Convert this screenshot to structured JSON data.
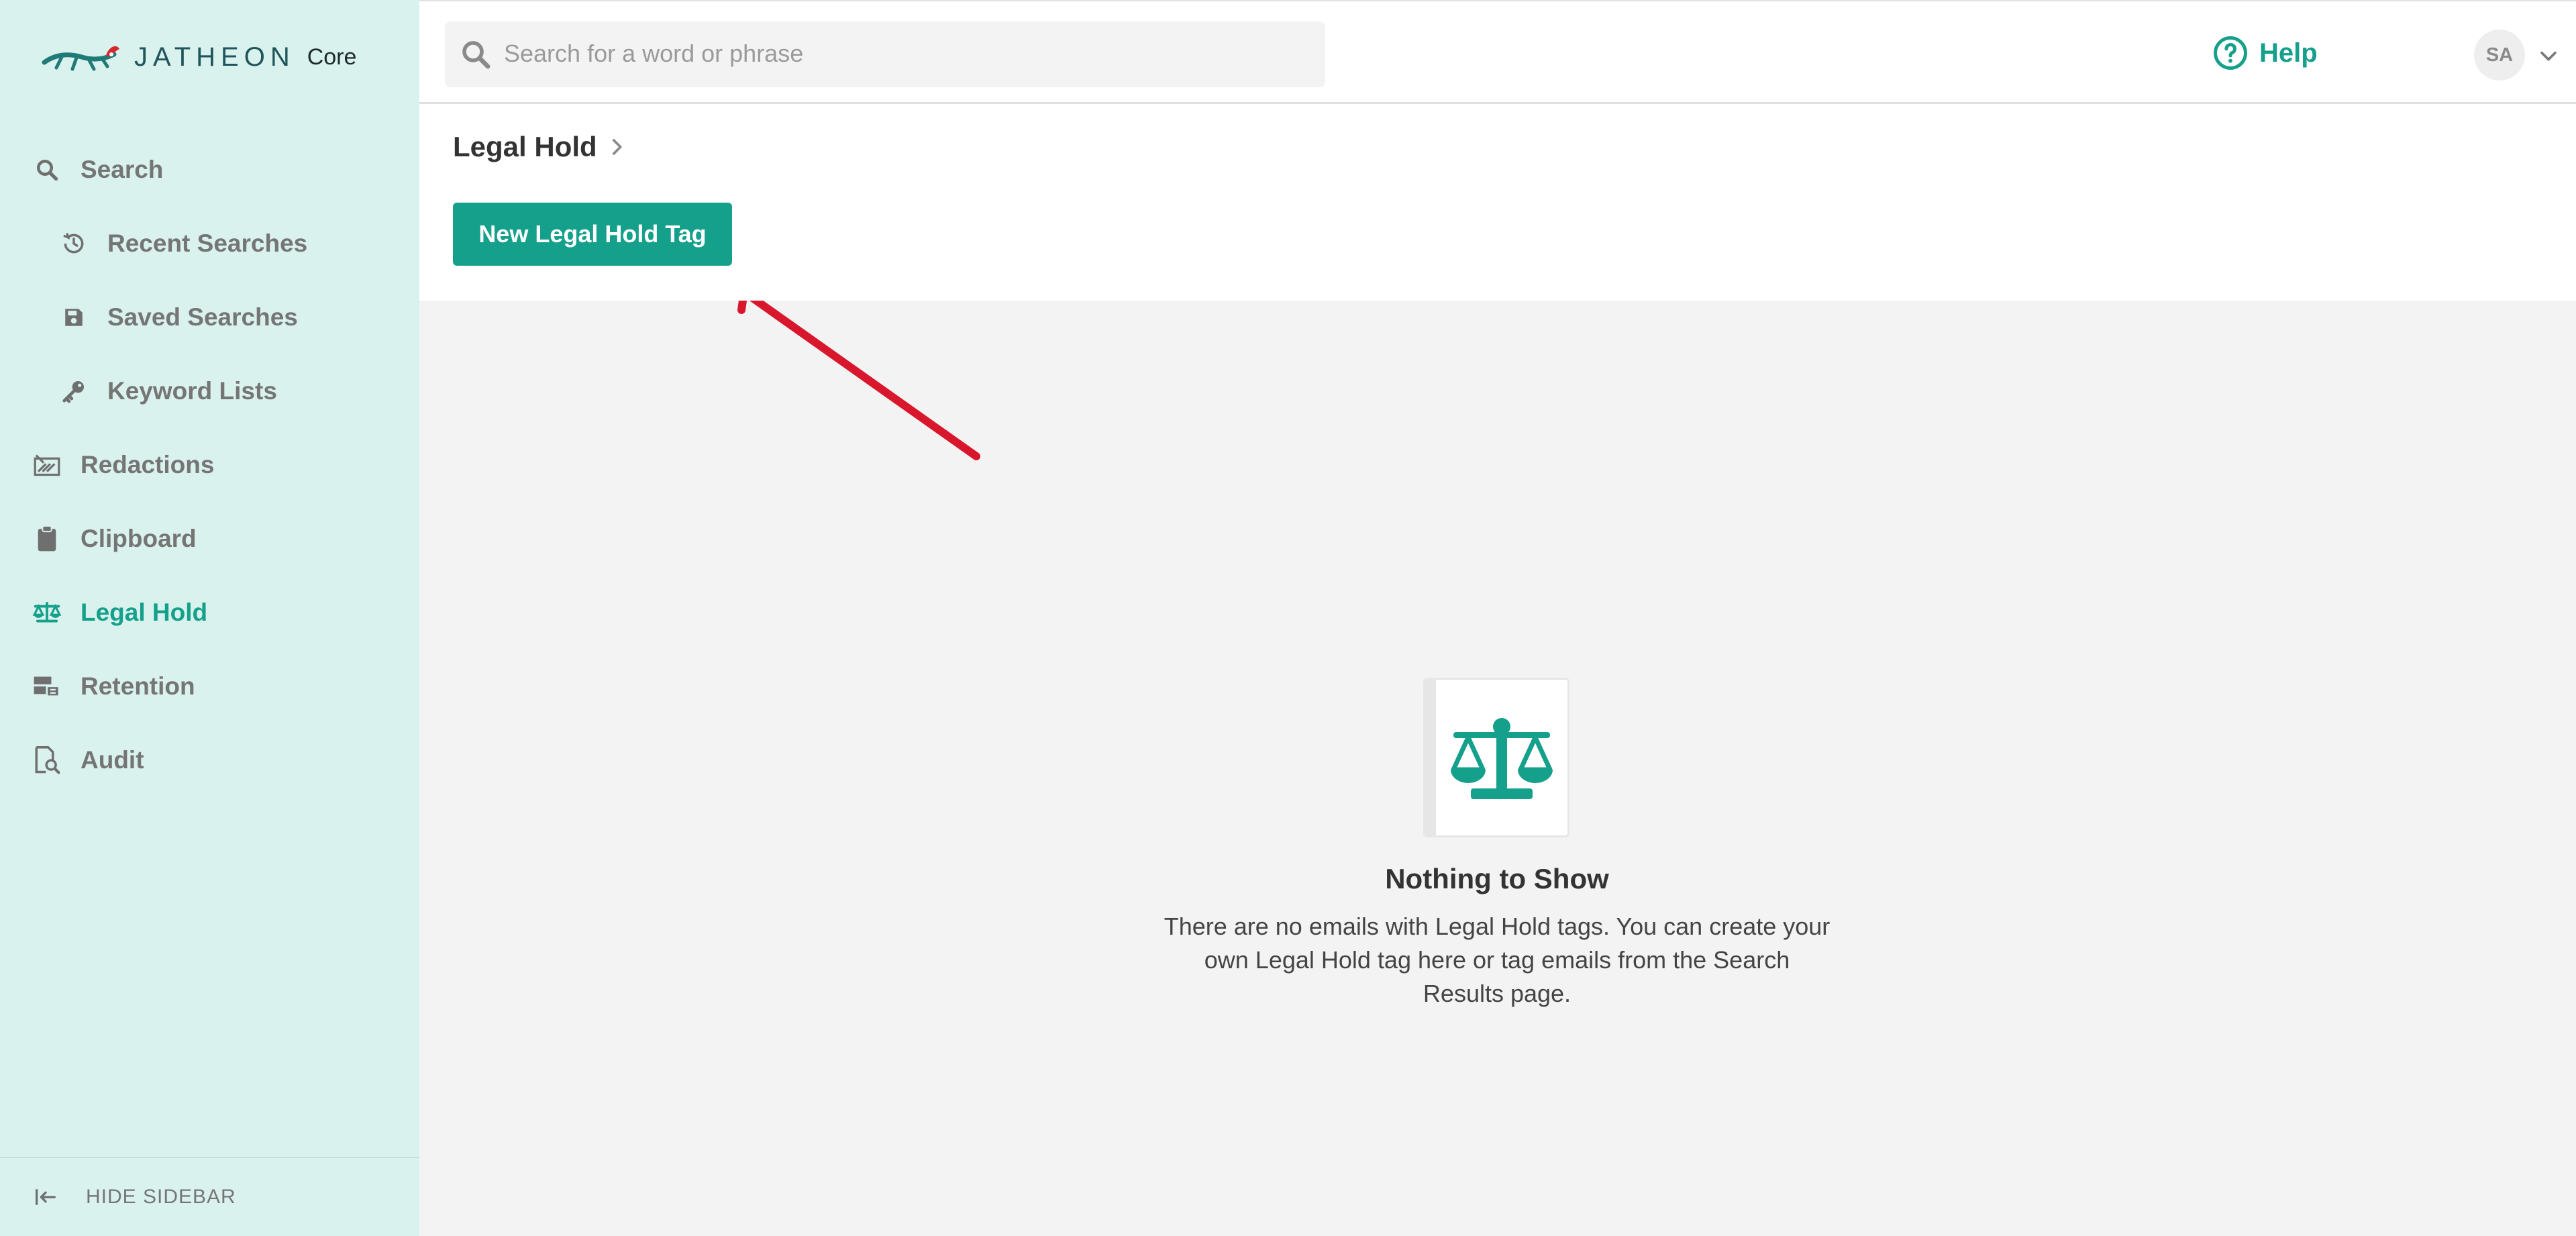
{
  "brand": {
    "name": "JATHEON",
    "product": "Core",
    "accent_color": "#14a08a",
    "logo_icon": "gecko-logo-icon"
  },
  "sidebar": {
    "items": [
      {
        "label": "Search",
        "icon": "search-icon"
      },
      {
        "label": "Recent Searches",
        "icon": "history-icon"
      },
      {
        "label": "Saved Searches",
        "icon": "save-icon"
      },
      {
        "label": "Keyword Lists",
        "icon": "key-icon"
      },
      {
        "label": "Redactions",
        "icon": "redaction-icon"
      },
      {
        "label": "Clipboard",
        "icon": "clipboard-icon"
      },
      {
        "label": "Legal Hold",
        "icon": "scale-icon",
        "active": true
      },
      {
        "label": "Retention",
        "icon": "retention-icon"
      },
      {
        "label": "Audit",
        "icon": "audit-icon"
      }
    ],
    "footer": {
      "label": "HIDE SIDEBAR",
      "icon": "collapse-left-icon"
    }
  },
  "topbar": {
    "search_placeholder": "Search for a word or phrase",
    "help_label": "Help",
    "user_initials": "SA"
  },
  "page": {
    "breadcrumb": "Legal Hold",
    "new_button_label": "New Legal Hold Tag"
  },
  "empty_state": {
    "icon": "scale-icon",
    "title": "Nothing to Show",
    "message": "There are no emails with Legal Hold tags. You can create your own Legal Hold tag here or tag emails from the Search Results page."
  },
  "annotation": {
    "color": "#d8162c",
    "icon": "red-arrow-annotation"
  }
}
